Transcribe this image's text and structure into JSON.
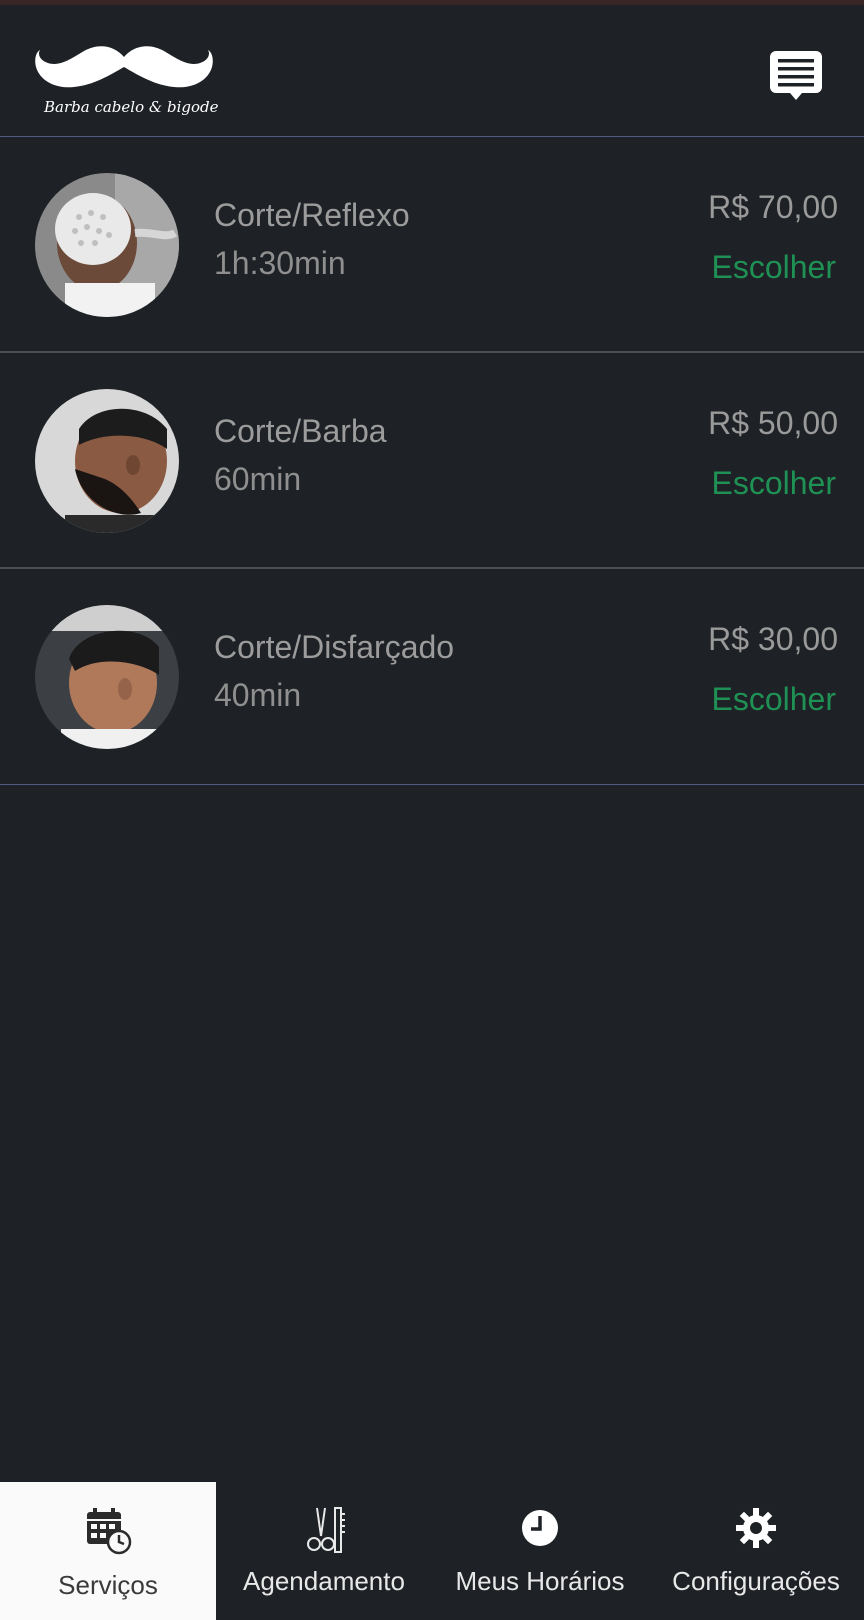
{
  "header": {
    "logo_text": "Barba cabelo & bigode",
    "chat_icon": "chat-list-icon"
  },
  "services": [
    {
      "name": "Corte/Reflexo",
      "duration": "1h:30min",
      "price": "R$ 70,00",
      "action": "Escolher"
    },
    {
      "name": "Corte/Barba",
      "duration": "60min",
      "price": "R$ 50,00",
      "action": "Escolher"
    },
    {
      "name": "Corte/Disfarçado",
      "duration": "40min",
      "price": "R$ 30,00",
      "action": "Escolher"
    }
  ],
  "nav": [
    {
      "label": "Serviços",
      "icon": "calendar-clock-icon",
      "active": true
    },
    {
      "label": "Agendamento",
      "icon": "scissors-comb-icon",
      "active": false
    },
    {
      "label": "Meus Horários",
      "icon": "clock-icon",
      "active": false
    },
    {
      "label": "Configurações",
      "icon": "gear-icon",
      "active": false
    }
  ],
  "colors": {
    "background": "#1e2125",
    "accent_green": "#1f9155",
    "divider_blue": "#4f5a86"
  }
}
